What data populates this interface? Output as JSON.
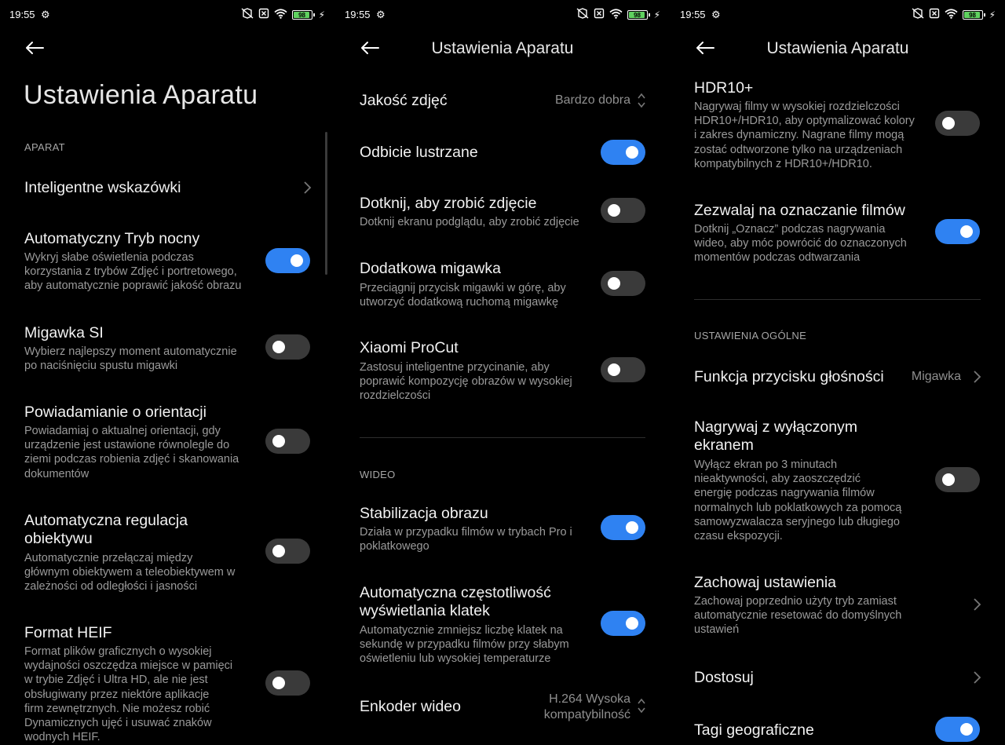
{
  "status": {
    "time": "19:55",
    "battery": "98"
  },
  "colors": {
    "accent": "#2f82f2",
    "toggle_off": "#3a3a3a",
    "text_secondary": "#9a9a9a"
  },
  "panel1": {
    "title": "Ustawienia Aparatu",
    "section_aparat": "APARAT",
    "items": [
      {
        "title": "Inteligentne wskazówki"
      },
      {
        "title": "Automatyczny Tryb nocny",
        "desc": [
          "Wykryj słabe oświetlenia podczas",
          "korzystania z trybów Zdjęć i portretowego,",
          "aby automatycznie poprawić jakość obrazu"
        ],
        "on": true
      },
      {
        "title": "Migawka SI",
        "desc": [
          "Wybierz najlepszy moment automatycznie",
          "po naciśnięciu spustu migawki"
        ],
        "on": false
      },
      {
        "title": "Powiadamianie o orientacji",
        "desc": [
          "Powiadamiaj o aktualnej orientacji, gdy",
          "urządzenie jest ustawione równolegle do",
          "ziemi podczas robienia zdjęć i skanowania",
          "dokumentów"
        ],
        "on": false
      },
      {
        "title": [
          "Automatyczna regulacja",
          "obiektywu"
        ],
        "desc": [
          "Automatycznie przełączaj między",
          "głównym obiektywem a teleobiektywem w",
          "zależności od odległości i jasności"
        ],
        "on": false
      },
      {
        "title": "Format HEIF",
        "desc": [
          "Format plików graficznych o wysokiej",
          "wydajności oszczędza miejsce w pamięci",
          "w trybie Zdjęć i Ultra HD, ale nie jest",
          "obsługiwany przez niektóre aplikacje",
          "firm zewnętrznych. Nie możesz robić",
          "Dynamicznych ujęć i usuwać znaków",
          "wodnych HEIF."
        ],
        "on": false
      }
    ]
  },
  "panel2": {
    "title": "Ustawienia Aparatu",
    "section_wideo": "WIDEO",
    "items": [
      {
        "title": "Jakość zdjęć",
        "value": "Bardzo dobra"
      },
      {
        "title": "Odbicie lustrzane",
        "on": true
      },
      {
        "title": "Dotknij, aby zrobić zdjęcie",
        "desc": [
          "Dotknij ekranu podglądu, aby zrobić zdjęcie"
        ],
        "on": false
      },
      {
        "title": "Dodatkowa migawka",
        "desc": [
          "Przeciągnij przycisk migawki w górę, aby",
          "utworzyć dodatkową ruchomą migawkę"
        ],
        "on": false
      },
      {
        "title": "Xiaomi ProCut",
        "desc": [
          "Zastosuj inteligentne przycinanie, aby",
          "poprawić kompozycję obrazów w wysokiej",
          "rozdzielczości"
        ],
        "on": false
      },
      {
        "title": "Stabilizacja obrazu",
        "desc": [
          "Działa w przypadku filmów w trybach Pro i",
          "poklatkowego"
        ],
        "on": true
      },
      {
        "title": [
          "Automatyczna częstotliwość",
          "wyświetlania klatek"
        ],
        "desc": [
          "Automatycznie zmniejsz liczbę klatek na",
          "sekundę w przypadku filmów przy słabym",
          "oświetleniu lub wysokiej temperaturze"
        ],
        "on": true
      },
      {
        "title": "Enkoder wideo",
        "value": [
          "H.264 Wysoka",
          "kompatybilność"
        ]
      }
    ]
  },
  "panel3": {
    "title": "Ustawienia Aparatu",
    "section_ogolne": "USTAWIENIA OGÓLNE",
    "items": [
      {
        "title": "HDR10+",
        "desc": [
          "Nagrywaj filmy w wysokiej rozdzielczości",
          "HDR10+/HDR10, aby optymalizować kolory",
          "i zakres dynamiczny. Nagrane filmy mogą",
          "zostać odtworzone tylko na urządzeniach",
          "kompatybilnych z HDR10+/HDR10."
        ],
        "on": false
      },
      {
        "title": "Zezwalaj na oznaczanie filmów",
        "desc": [
          "Dotknij „Oznacz” podczas nagrywania",
          "wideo, aby móc powrócić do oznaczonych",
          "momentów podczas odtwarzania"
        ],
        "on": true
      },
      {
        "title": "Funkcja przycisku głośności",
        "value": "Migawka"
      },
      {
        "title": [
          "Nagrywaj z wyłączonym",
          "ekranem"
        ],
        "desc": [
          "Wyłącz ekran po 3 minutach",
          "nieaktywności, aby zaoszczędzić",
          "energię podczas nagrywania filmów",
          "normalnych lub poklatkowych za pomocą",
          "samowyzwalacza seryjnego lub długiego",
          "czasu ekspozycji."
        ],
        "on": false
      },
      {
        "title": "Zachowaj ustawienia",
        "desc": [
          "Zachowaj poprzednio użyty tryb zamiast",
          "automatycznie resetować do domyślnych",
          "ustawień"
        ]
      },
      {
        "title": "Dostosuj"
      },
      {
        "title": "Tagi geograficzne",
        "on": true
      }
    ]
  }
}
